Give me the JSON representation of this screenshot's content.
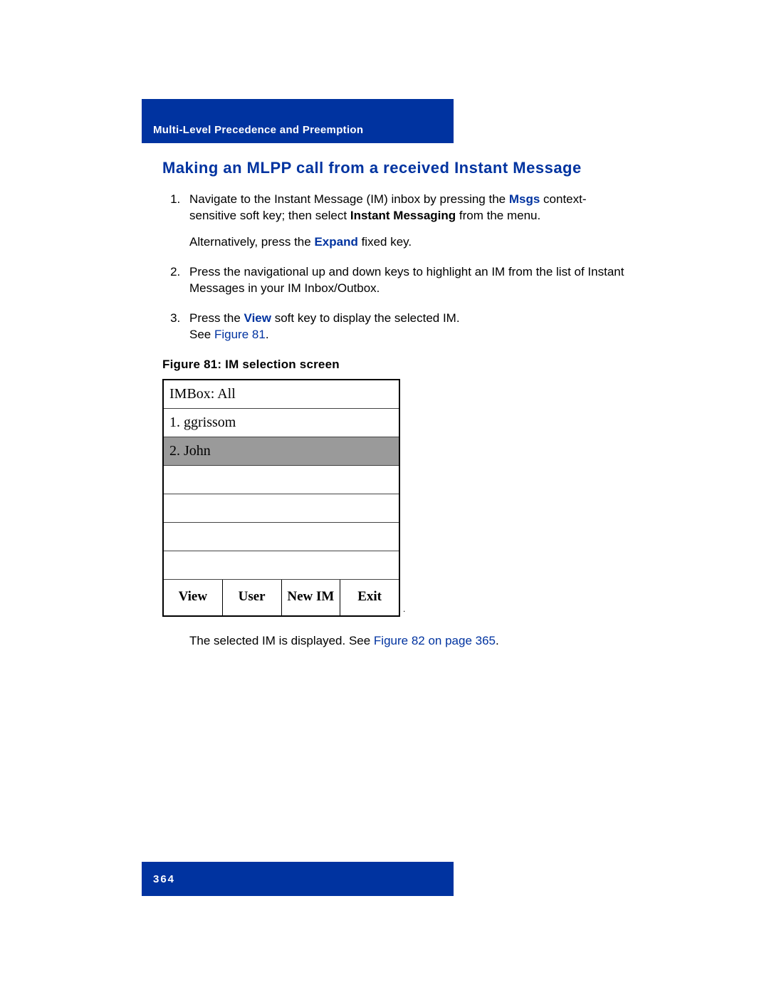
{
  "header": {
    "chapter_title": "Multi-Level Precedence and Preemption"
  },
  "section": {
    "title": "Making an MLPP call from a received Instant Message"
  },
  "steps": {
    "s1_a": "Navigate to the Instant Message (IM) inbox by pressing the ",
    "s1_msgs": "Msgs",
    "s1_b": " context-sensitive soft key; then select ",
    "s1_im": "Instant Messaging",
    "s1_c": " from the menu.",
    "s1_alt_a": "Alternatively, press the ",
    "s1_alt_expand": "Expand",
    "s1_alt_b": " fixed key.",
    "s2": "Press the navigational up and down keys to highlight an IM from the list of Instant Messages in your IM Inbox/Outbox.",
    "s3_a": "Press the ",
    "s3_view": "View",
    "s3_b": " soft key to display the selected IM.",
    "s3_see": "See ",
    "s3_figref": "Figure 81",
    "s3_period": "."
  },
  "figure": {
    "caption": "Figure 81: IM selection screen",
    "rows": {
      "title": "IMBox: All",
      "r1": "1. ggrissom",
      "r2": "2. John"
    },
    "softkeys": {
      "k1": "View",
      "k2": "User",
      "k3": "New IM",
      "k4": "Exit"
    },
    "trailing_dot": "."
  },
  "after_figure": {
    "text_a": "The selected IM is displayed. See ",
    "link": "Figure 82 on page 365",
    "text_b": "."
  },
  "footer": {
    "page_number": "364"
  }
}
